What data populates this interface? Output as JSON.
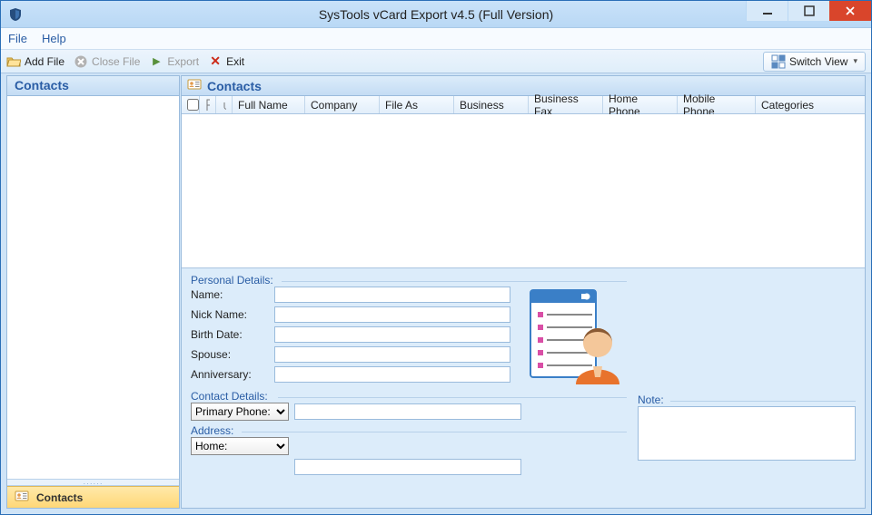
{
  "titlebar": {
    "title": "SysTools vCard Export v4.5 (Full Version)"
  },
  "menubar": {
    "file": "File",
    "help": "Help"
  },
  "toolbar": {
    "add_file": "Add File",
    "close_file": "Close File",
    "export": "Export",
    "exit": "Exit",
    "switch_view": "Switch View"
  },
  "leftpane": {
    "header": "Contacts",
    "bottom_item": "Contacts"
  },
  "rightpane": {
    "header": "Contacts",
    "columns": {
      "full_name": "Full Name",
      "company": "Company",
      "file_as": "File As",
      "business": "Business",
      "business_fax": "Business Fax",
      "home_phone": "Home Phone",
      "mobile_phone": "Mobile Phone",
      "categories": "Categories"
    }
  },
  "details": {
    "personal_legend": "Personal Details:",
    "name_lbl": "Name:",
    "nick_lbl": "Nick Name:",
    "birth_lbl": "Birth Date:",
    "spouse_lbl": "Spouse:",
    "anniv_lbl": "Anniversary:",
    "contact_legend": "Contact Details:",
    "address_legend": "Address:",
    "note_legend": "Note:",
    "primary_phone_option": "Primary Phone:",
    "home_option": "Home:"
  }
}
